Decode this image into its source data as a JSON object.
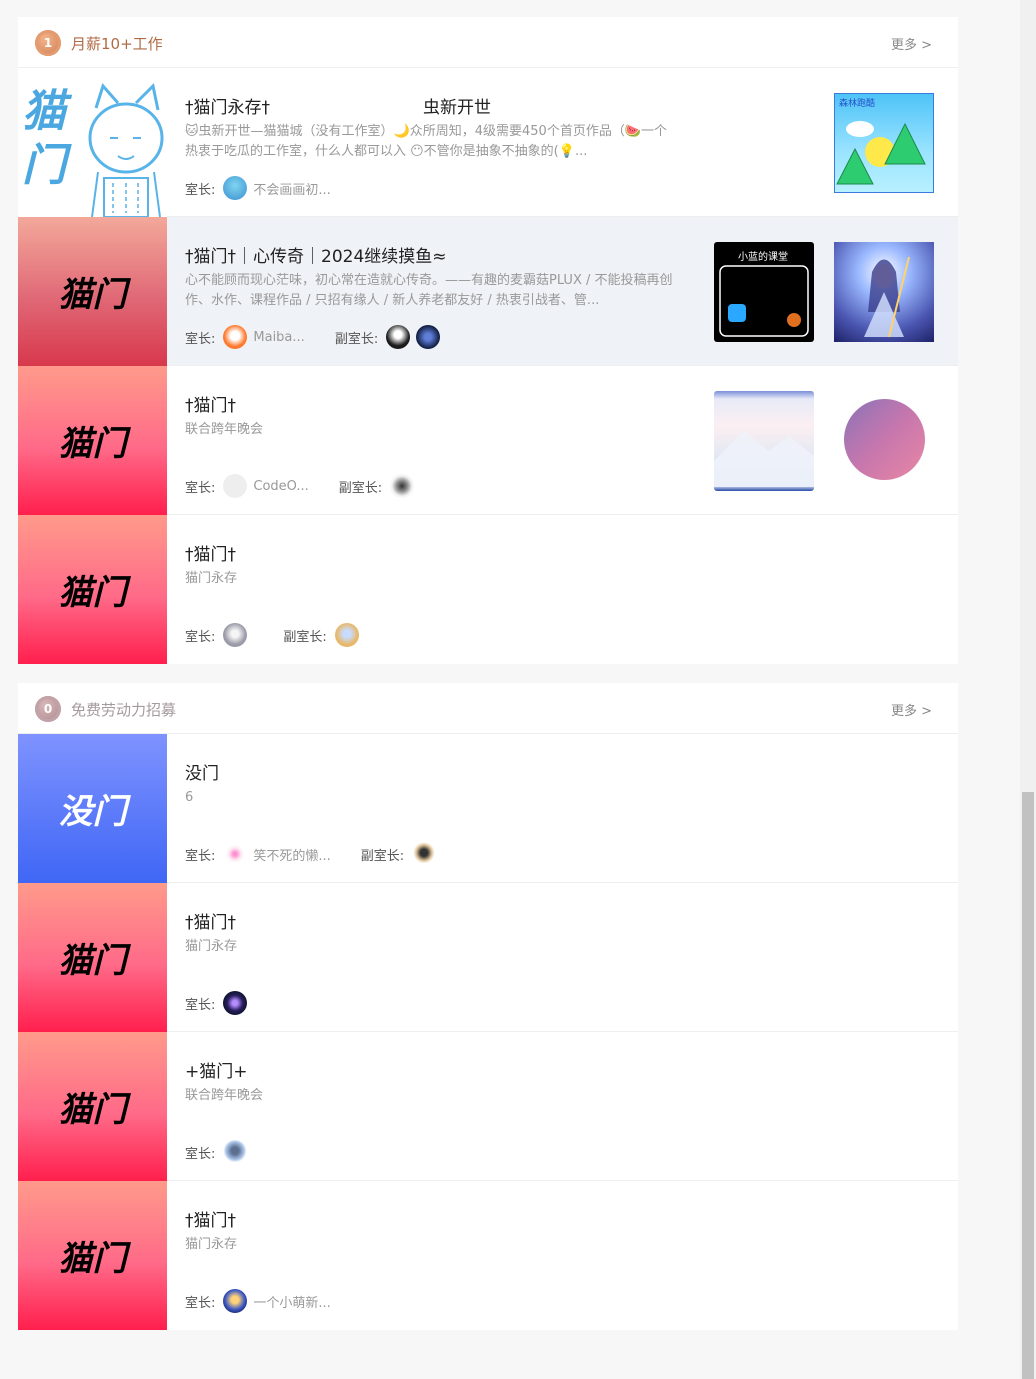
{
  "sections": [
    {
      "title": "月薪10+工作",
      "medal": "1",
      "more": "更多 >",
      "rows": [
        {
          "cover": "",
          "title": "†猫门永存†",
          "title2": "虫新开世",
          "desc": "🐱虫新开世—猫猫城（没有工作室）🌙众所周知，4级需要450个首页作品（🍉一个热衷于吃瓜的工作室，什么人都可以入 😶不管你是抽象不抽象的(💡...",
          "leader_label": "室长:",
          "leader_name": "不会画画初...",
          "vice_label": "",
          "thumbs": [
            "森林跑酷"
          ]
        },
        {
          "cover": "猫门",
          "title": "†猫门†｜心传奇｜2024继续摸鱼≈",
          "desc": "心不能顾而现心茫味，初心常在造就心传奇。——有趣的麦霸菇PLUX / 不能投稿再创作、水作、课程作品 / 只招有缘人 / 新人养老都友好 / 热衷引战者、管...",
          "leader_label": "室长:",
          "leader_name": "Maiba...",
          "vice_label": "副室长:",
          "thumbs": [
            "小蓝的课堂",
            ""
          ]
        },
        {
          "cover": "猫门",
          "title": "†猫门†",
          "desc": "联合跨年晚会",
          "leader_label": "室长:",
          "leader_name": "CodeO...",
          "vice_label": "副室长:",
          "thumbs": [
            "",
            ""
          ]
        },
        {
          "cover": "猫门",
          "title": "†猫门†",
          "desc": "猫门永存",
          "leader_label": "室长:",
          "leader_name": "",
          "vice_label": "副室长:",
          "thumbs": []
        }
      ]
    },
    {
      "title": "免费劳动力招募",
      "medal": "0",
      "more": "更多 >",
      "rows": [
        {
          "cover": "没门",
          "title": "没门",
          "desc": "6",
          "leader_label": "室长:",
          "leader_name": "笑不死的懒...",
          "vice_label": "副室长:",
          "thumbs": []
        },
        {
          "cover": "猫门",
          "title": "†猫门†",
          "desc": "猫门永存",
          "leader_label": "室长:",
          "leader_name": "",
          "vice_label": "",
          "thumbs": []
        },
        {
          "cover": "猫门",
          "title": "+猫门+",
          "desc": "联合跨年晚会",
          "leader_label": "室长:",
          "leader_name": "",
          "vice_label": "",
          "thumbs": []
        },
        {
          "cover": "猫门",
          "title": "†猫门†",
          "desc": "猫门永存",
          "leader_label": "室长:",
          "leader_name": "一个小萌新...",
          "vice_label": "",
          "thumbs": []
        }
      ]
    }
  ],
  "first_cover_text": "猫门"
}
